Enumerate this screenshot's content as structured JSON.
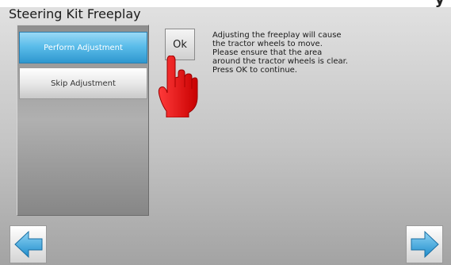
{
  "header": {
    "partial_top_text": "y",
    "title": "Steering Kit Freeplay"
  },
  "menu": {
    "items": [
      {
        "label": "Perform Adjustment",
        "selected": true
      },
      {
        "label": "Skip Adjustment",
        "selected": false
      }
    ]
  },
  "ok_button": {
    "label": "Ok"
  },
  "message": {
    "lines": [
      "Adjusting the freeplay will cause",
      "the tractor wheels to move.",
      "Please ensure that the area",
      "around the tractor wheels is clear.",
      "Press OK to continue."
    ]
  },
  "navigation": {
    "back_icon": "arrow-left-icon",
    "next_icon": "arrow-right-icon"
  },
  "colors": {
    "accent_blue": "#3aa6dc",
    "hand_red": "#e01010"
  }
}
